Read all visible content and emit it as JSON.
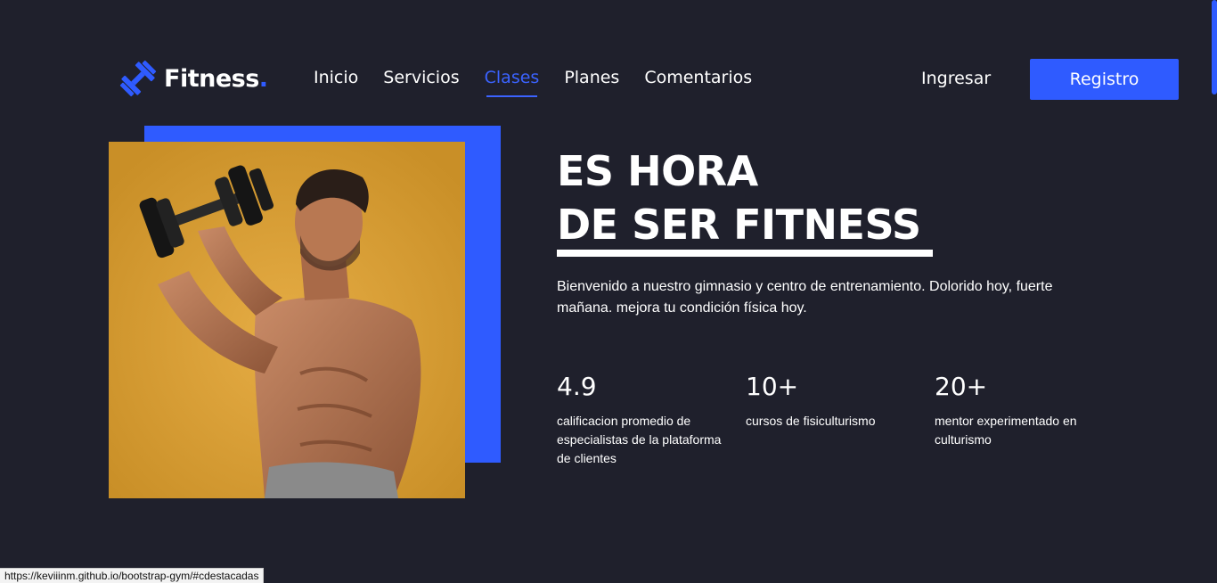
{
  "brand": {
    "name": "Fitness",
    "dot": ".",
    "icon": "dumbbell-icon",
    "accent_color": "#2f5bff"
  },
  "nav": {
    "items": [
      {
        "label": "Inicio"
      },
      {
        "label": "Servicios"
      },
      {
        "label": "Clases",
        "active": true
      },
      {
        "label": "Planes"
      },
      {
        "label": "Comentarios"
      }
    ],
    "login_label": "Ingresar",
    "signup_label": "Registro"
  },
  "hero": {
    "title_line1": "ES HORA",
    "title_line2": "DE SER FITNESS",
    "description": "Bienvenido a nuestro gimnasio y centro de entrenamiento. Dolorido hoy, fuerte mañana. mejora tu condición física hoy.",
    "image": "man-lifting-dumbbell-photo",
    "stats": [
      {
        "value": "4.9",
        "label": "calificacion promedio de especialistas de la plataforma de clientes"
      },
      {
        "value": "10+",
        "label": "cursos de fisiculturismo"
      },
      {
        "value": "20+",
        "label": "mentor experimentado en culturismo"
      }
    ]
  },
  "status_bar": {
    "url": "https://keviiinm.github.io/bootstrap-gym/#cdestacadas"
  },
  "colors": {
    "background": "#1f202c",
    "accent": "#2f5bff",
    "photo_background": "#d99f33"
  }
}
